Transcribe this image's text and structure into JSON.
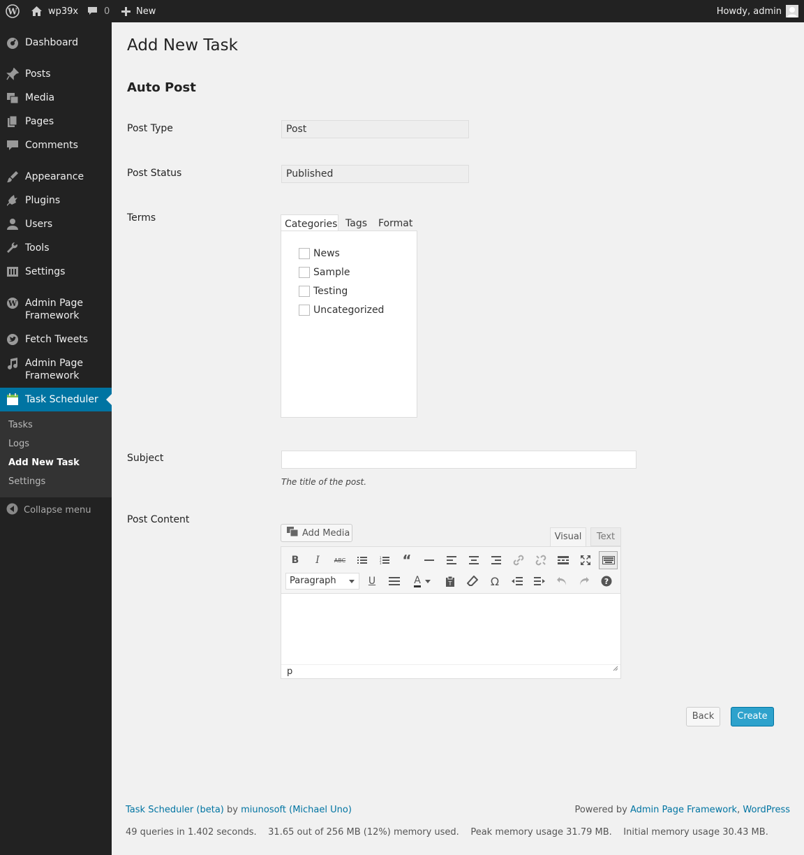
{
  "admin_bar": {
    "site_name": "wp39x",
    "comments_count": "0",
    "new_label": "New",
    "howdy": "Howdy, admin"
  },
  "sidebar": {
    "items": [
      {
        "label": "Dashboard",
        "icon": "dashboard-icon"
      },
      {
        "label": "Posts",
        "icon": "pin-icon"
      },
      {
        "label": "Media",
        "icon": "media-icon"
      },
      {
        "label": "Pages",
        "icon": "pages-icon"
      },
      {
        "label": "Comments",
        "icon": "comment-icon"
      },
      {
        "label": "Appearance",
        "icon": "brush-icon"
      },
      {
        "label": "Plugins",
        "icon": "plugin-icon"
      },
      {
        "label": "Users",
        "icon": "user-icon"
      },
      {
        "label": "Tools",
        "icon": "wrench-icon"
      },
      {
        "label": "Settings",
        "icon": "settings-icon"
      },
      {
        "label_line1": "Admin Page",
        "label_line2": "Framework",
        "icon": "wordpress-icon"
      },
      {
        "label": "Fetch Tweets",
        "icon": "twitter-icon"
      },
      {
        "label_line1": "Admin Page",
        "label_line2": "Framework",
        "icon": "music-icon"
      },
      {
        "label": "Task Scheduler",
        "icon": "calendar-icon"
      }
    ],
    "submenu": [
      "Tasks",
      "Logs",
      "Add New Task",
      "Settings"
    ],
    "collapse_label": "Collapse menu"
  },
  "page": {
    "title": "Add New Task",
    "section": "Auto Post"
  },
  "form": {
    "post_type_label": "Post Type",
    "post_type_value": "Post",
    "post_status_label": "Post Status",
    "post_status_value": "Published",
    "terms_label": "Terms",
    "terms_tabs": [
      "Categories",
      "Tags",
      "Format"
    ],
    "categories": [
      "News",
      "Sample",
      "Testing",
      "Uncategorized"
    ],
    "subject_label": "Subject",
    "subject_value": "",
    "subject_desc": "The title of the post.",
    "content_label": "Post Content",
    "add_media": "Add Media",
    "editor_tab_visual": "Visual",
    "editor_tab_text": "Text",
    "paragraph_select": "Paragraph",
    "status_path": "p",
    "back_label": "Back",
    "create_label": "Create"
  },
  "footer": {
    "plugin_link": "Task Scheduler (beta)",
    "by": "by",
    "author_link": "miunosoft (Michael Uno)",
    "powered": "Powered by",
    "apf_link": "Admin Page Framework",
    "comma": ",",
    "wp_link": "WordPress",
    "stats": "49 queries in 1.402 seconds.    31.65 out of 256 MB (12%) memory used.    Peak memory usage 31.79 MB.    Initial memory usage 30.43 MB."
  },
  "colors": {
    "menu_bg": "#222222",
    "accent": "#0074a2",
    "primary_button": "#2ea2cc"
  }
}
